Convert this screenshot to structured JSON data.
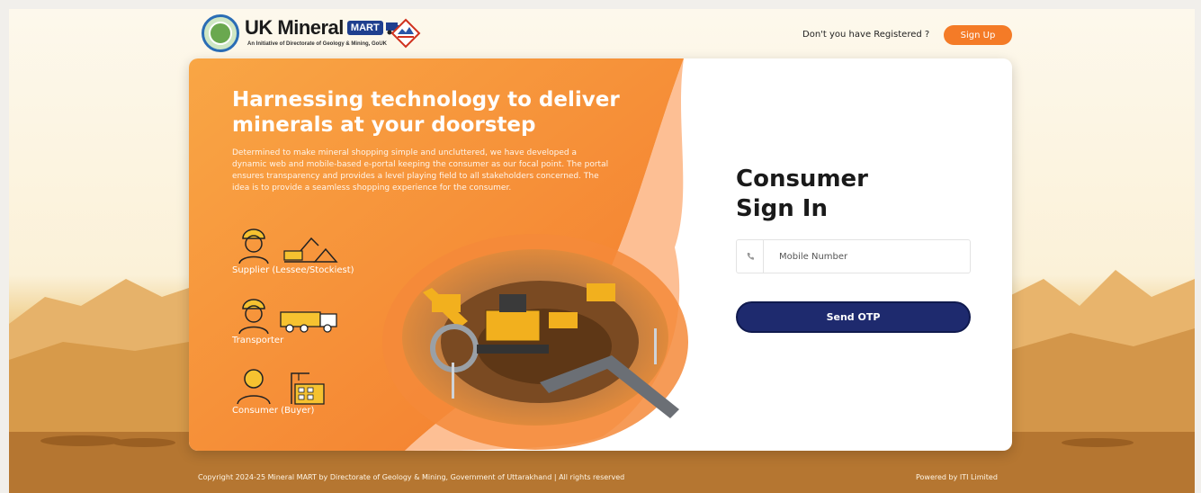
{
  "header": {
    "brand_name": "UK Mineral",
    "brand_badge": "MART",
    "brand_tagline": "An Initiative of Directorate of Geology & Mining, GoUK",
    "register_prompt": "Don't you have Registered ?",
    "signup_label": "Sign Up"
  },
  "hero": {
    "headline": "Harnessing technology to deliver minerals at your doorstep",
    "description": "Determined to make mineral shopping simple and uncluttered, we have developed a dynamic web and mobile-based e-portal keeping the consumer as our focal point. The portal ensures transparency and provides a level playing field to all stakeholders concerned. The idea is to provide a seamless shopping experience for the consumer.",
    "roles": [
      {
        "label": "Supplier (Lessee/Stockiest)",
        "icon": "excavator-icon"
      },
      {
        "label": "Transporter",
        "icon": "dump-truck-icon"
      },
      {
        "label": "Consumer (Buyer)",
        "icon": "building-crane-icon"
      }
    ]
  },
  "signin": {
    "title_line1": "Consumer",
    "title_line2": "Sign In",
    "mobile_placeholder": "Mobile Number",
    "mobile_value": "",
    "otp_label": "Send OTP"
  },
  "footer": {
    "copyright": "Copyright 2024-25 Mineral MART by Directorate of Geology & Mining, Government of Uttarakhand | All rights reserved",
    "powered_by": "Powered by ITI Limited"
  },
  "colors": {
    "accent_orange": "#f47b27",
    "button_navy": "#1e2a6e",
    "panel_orange_light": "#f9a645",
    "panel_orange_dark": "#f37a2c"
  }
}
